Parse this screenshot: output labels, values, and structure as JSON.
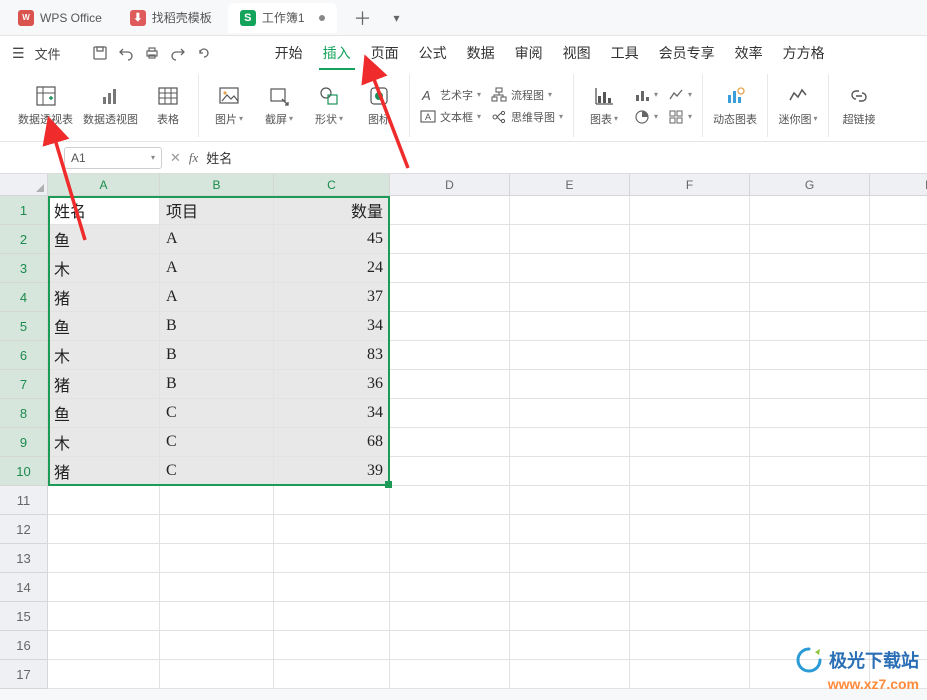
{
  "tabs": {
    "app": "WPS Office",
    "doc1": "找稻壳模板",
    "doc2": "工作簿1"
  },
  "menu": {
    "file": "文件",
    "items": [
      "开始",
      "插入",
      "页面",
      "公式",
      "数据",
      "审阅",
      "视图",
      "工具",
      "会员专享",
      "效率",
      "方方格"
    ],
    "active": 1
  },
  "ribbon": {
    "g1": {
      "pivot_table": "数据透视表",
      "pivot_chart": "数据透视图",
      "table": "表格"
    },
    "g2": {
      "pic": "图片",
      "screenshot": "截屏",
      "shape": "形状",
      "icon": "图标"
    },
    "g3": {
      "wordart": "艺术字",
      "textbox": "文本框",
      "flowchart": "流程图",
      "mindmap": "思维导图"
    },
    "g4": {
      "chart": "图表"
    },
    "g5": {
      "dyn": "动态图表"
    },
    "g6": {
      "spark": "迷你图"
    },
    "g7": {
      "link": "超链接"
    }
  },
  "fx": {
    "cell": "A1",
    "value": "姓名"
  },
  "cols": [
    "A",
    "B",
    "C",
    "D",
    "E",
    "F",
    "G",
    "H"
  ],
  "rows": [
    1,
    2,
    3,
    4,
    5,
    6,
    7,
    8,
    9,
    10,
    11,
    12,
    13,
    14,
    15,
    16,
    17
  ],
  "table": {
    "header": [
      "姓名",
      "项目",
      "数量"
    ],
    "rows": [
      [
        "鱼",
        "A",
        "45"
      ],
      [
        "木",
        "A",
        "24"
      ],
      [
        "猪",
        "A",
        "37"
      ],
      [
        "鱼",
        "B",
        "34"
      ],
      [
        "木",
        "B",
        "83"
      ],
      [
        "猪",
        "B",
        "36"
      ],
      [
        "鱼",
        "C",
        "34"
      ],
      [
        "木",
        "C",
        "68"
      ],
      [
        "猪",
        "C",
        "39"
      ]
    ]
  },
  "watermark": {
    "name": "极光下载站",
    "url": "www.xz7.com"
  }
}
